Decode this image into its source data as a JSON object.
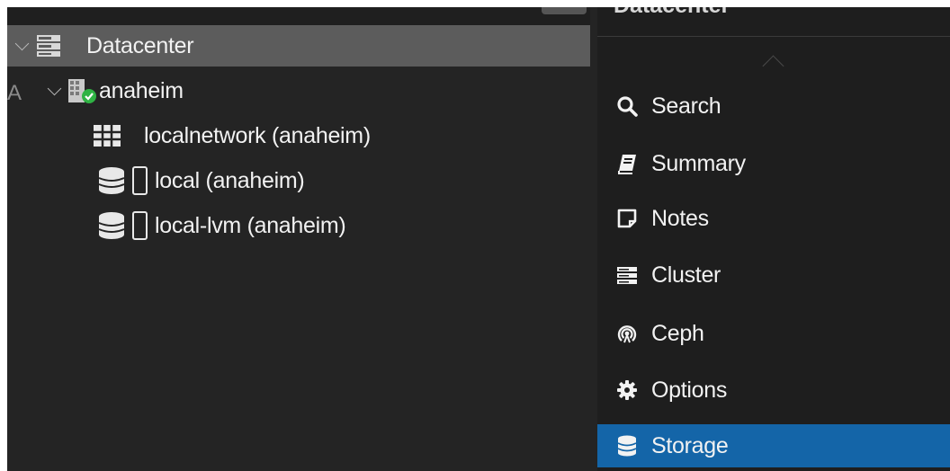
{
  "tree": {
    "root": {
      "label": "Datacenter",
      "icon": "server-stack-icon"
    },
    "node": {
      "label": "anaheim",
      "icon": "node-online-icon"
    },
    "children": [
      {
        "label": "localnetwork (anaheim)",
        "icon": "sdn-grid-icon"
      },
      {
        "label": "local (anaheim)",
        "icon": "storage-icon"
      },
      {
        "label": "local-lvm (anaheim)",
        "icon": "storage-icon"
      }
    ]
  },
  "stray_text": "A",
  "nav": {
    "header_title": "Datacenter",
    "items": [
      {
        "label": "Search",
        "icon": "search-icon"
      },
      {
        "label": "Summary",
        "icon": "book-icon"
      },
      {
        "label": "Notes",
        "icon": "notes-icon"
      },
      {
        "label": "Cluster",
        "icon": "server-icon"
      },
      {
        "label": "Ceph",
        "icon": "ceph-icon"
      },
      {
        "label": "Options",
        "icon": "gear-icon"
      },
      {
        "label": "Storage",
        "icon": "database-icon"
      }
    ],
    "active_index": 6
  },
  "colors": {
    "background": "#242424",
    "selected_row": "#5c5c5c",
    "active_nav": "#1465a8",
    "text": "#f2f2f2",
    "node_status_ok": "#2fb344"
  }
}
